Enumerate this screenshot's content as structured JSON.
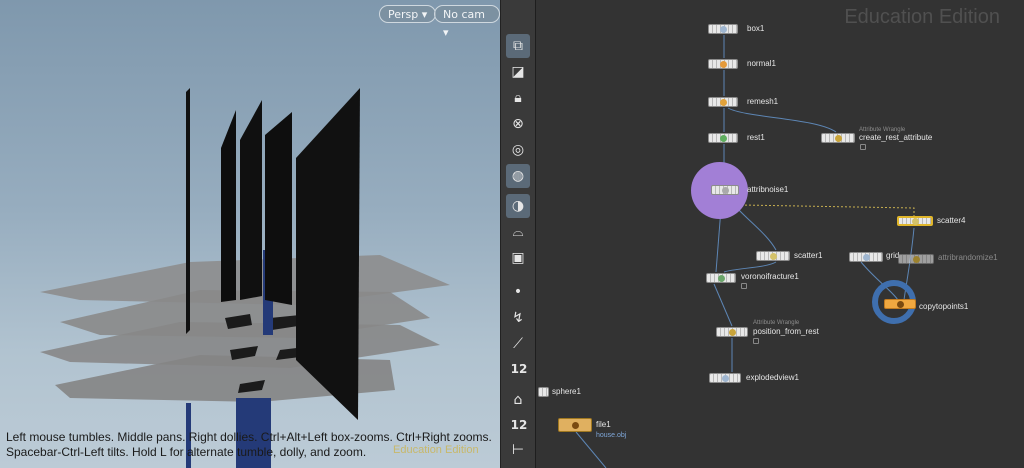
{
  "viewport": {
    "persp_label": "Persp",
    "camera_label": "No cam",
    "hint_line1": "Left mouse tumbles. Middle pans. Right dollies. Ctrl+Alt+Left box-zooms. Ctrl+Right zooms.",
    "hint_line2": "Spacebar-Ctrl-Left tilts. Hold L for alternate tumble, dolly, and zoom.",
    "watermark": "Education Edition"
  },
  "toolbar": {
    "points_number": "12",
    "prims_number": "12",
    "icons": [
      "view-mode-icon",
      "selection-icon",
      "lock-icon",
      "ghost-icon",
      "display-options-icon",
      "light-icon",
      "shading-icon",
      "visualizer-icon",
      "snapshot-icon",
      "point-icon",
      "lasso-icon",
      "pin-icon",
      "point-number-icon",
      "brush-icon",
      "prim-number-icon",
      "ruler-icon"
    ]
  },
  "network": {
    "watermark": "Education Edition",
    "colors": {
      "attribnoise_highlight": "#a27fd6",
      "copytopoints_highlight": "#3f6fae",
      "scatter4_outline": "#e0b62b",
      "file_node": "#e0b060",
      "wire": "#5d86b5"
    },
    "nodes": [
      {
        "id": "box1",
        "label": "box1"
      },
      {
        "id": "normal1",
        "label": "normal1"
      },
      {
        "id": "remesh1",
        "label": "remesh1"
      },
      {
        "id": "rest1",
        "label": "rest1"
      },
      {
        "id": "create_rest_attribute",
        "label": "create_rest_attribute",
        "type": "Attribute Wrangle"
      },
      {
        "id": "attribnoise1",
        "label": "attribnoise1"
      },
      {
        "id": "scatter1",
        "label": "scatter1"
      },
      {
        "id": "voronoifracture1",
        "label": "voronoifracture1"
      },
      {
        "id": "scatter4",
        "label": "scatter4"
      },
      {
        "id": "grid",
        "label": "grid"
      },
      {
        "id": "attribrandomize1",
        "label": "attribrandomize1"
      },
      {
        "id": "copytopoints1",
        "label": "copytopoints1"
      },
      {
        "id": "position_from_rest",
        "label": "position_from_rest",
        "type": "Attribute Wrangle"
      },
      {
        "id": "explodedview1",
        "label": "explodedview1"
      },
      {
        "id": "sphere1",
        "label": "sphere1"
      },
      {
        "id": "file1",
        "label": "file1",
        "sublabel": "house.obj"
      }
    ]
  }
}
